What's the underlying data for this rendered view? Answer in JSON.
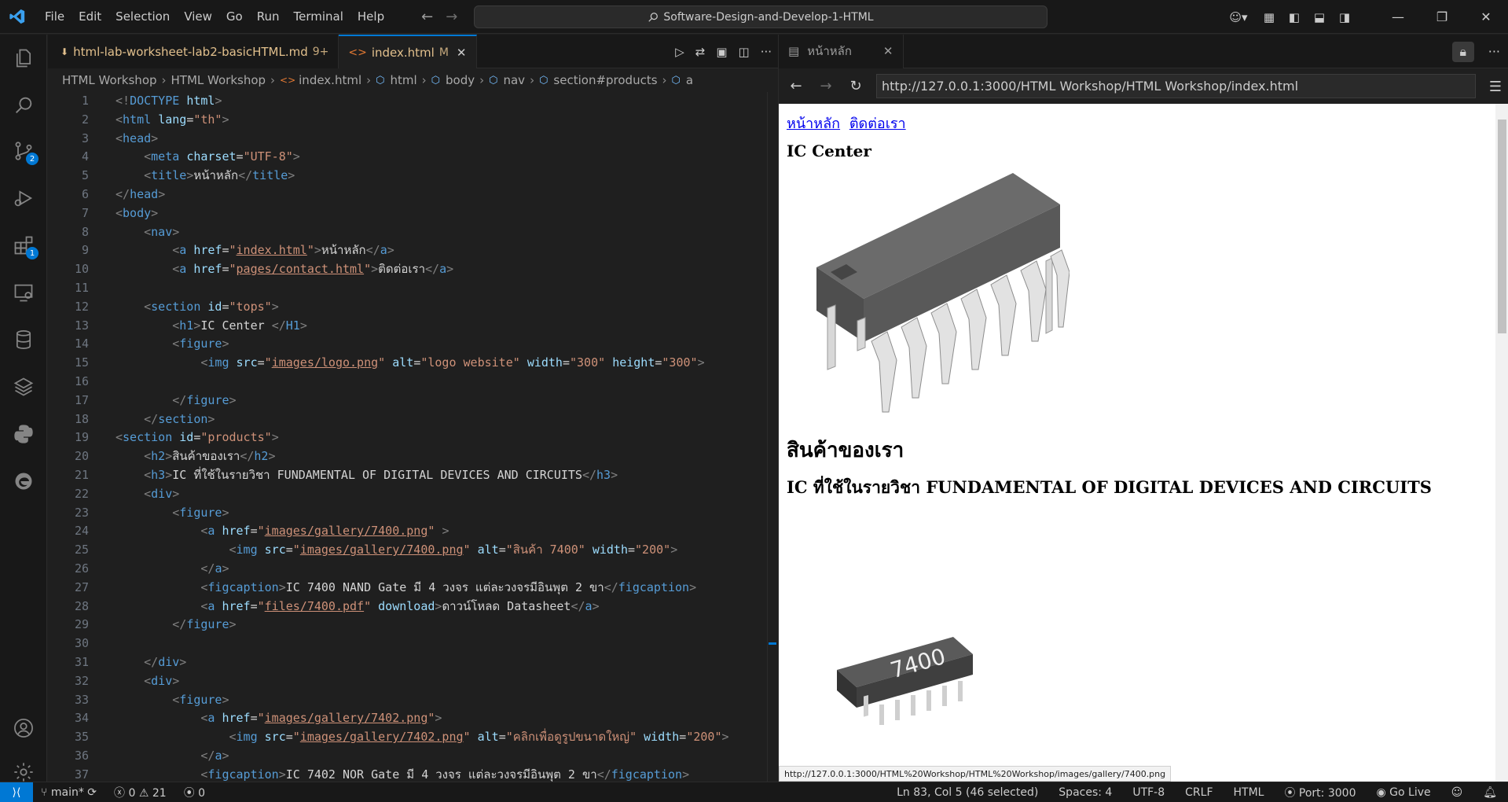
{
  "titlebar": {
    "menu": [
      "File",
      "Edit",
      "Selection",
      "View",
      "Go",
      "Run",
      "Terminal",
      "Help"
    ],
    "search_text": "Software-Design-and-Develop-1-HTML",
    "icons": [
      "copilot-icon",
      "layout-customize-icon",
      "toggle-sidebar-icon",
      "toggle-panel-icon",
      "toggle-secondary-sidebar-icon"
    ],
    "window_buttons": [
      "minimize",
      "restore",
      "close"
    ]
  },
  "activitybar": {
    "items": [
      {
        "name": "explorer-icon"
      },
      {
        "name": "search-icon"
      },
      {
        "name": "source-control-icon",
        "badge": "2"
      },
      {
        "name": "run-debug-icon"
      },
      {
        "name": "extensions-icon",
        "badge": "1"
      },
      {
        "name": "remote-explorer-icon"
      },
      {
        "name": "database-icon"
      },
      {
        "name": "layers-icon"
      },
      {
        "name": "python-icon"
      },
      {
        "name": "edge-icon"
      }
    ],
    "bottom": [
      {
        "name": "account-icon"
      },
      {
        "name": "manage-gear-icon"
      }
    ]
  },
  "editor": {
    "tabs": [
      {
        "label": "html-lab-worksheet-lab2-basicHTML.md",
        "status": "9+",
        "active": false
      },
      {
        "label": "index.html",
        "status": "M",
        "active": true
      }
    ],
    "breadcrumb": [
      "HTML Workshop",
      "HTML Workshop",
      "index.html",
      "html",
      "body",
      "nav",
      "section#products",
      "a"
    ],
    "lines": [
      "<!DOCTYPE html>",
      "<html lang=\"th\">",
      "<head>",
      "    <meta charset=\"UTF-8\">",
      "    <title>หน้าหลัก</title>",
      "</head>",
      "<body>",
      "    <nav>",
      "        <a href=\"index.html\">หน้าหลัก</a>",
      "        <a href=\"pages/contact.html\">ติดต่อเรา</a>",
      "",
      "    <section id=\"tops\">",
      "        <h1>IC Center </H1>",
      "        <figure>",
      "            <img src=\"images/logo.png\" alt=\"logo website\" width=\"300\" height=\"300\">",
      "",
      "        </figure>",
      "    </section>",
      "<section id=\"products\">",
      "    <h2>สินค้าของเรา</h2>",
      "    <h3>IC ที่ใช้ในรายวิชา FUNDAMENTAL OF DIGITAL DEVICES AND CIRCUITS</h3>",
      "    <div>",
      "        <figure>",
      "            <a href=\"images/gallery/7400.png\" >",
      "                <img src=\"images/gallery/7400.png\" alt=\"สินค้า 7400\" width=\"200\">",
      "            </a>",
      "            <figcaption>IC 7400 NAND Gate มี 4 วงจร แต่ละวงจรมีอินพุต 2 ขา</figcaption>",
      "            <a href=\"files/7400.pdf\" download>ดาวน์โหลด Datasheet</a>",
      "        </figure>",
      "",
      "    </div>",
      "    <div>",
      "        <figure>",
      "            <a href=\"images/gallery/7402.png\">",
      "                <img src=\"images/gallery/7402.png\" alt=\"คลิกเพื่อดูรูปขนาดใหญ่\" width=\"200\">",
      "            </a>",
      "            <figcaption>IC 7402 NOR Gate มี 4 วงจร แต่ละวงจรมีอินพุต 2 ขา</figcaption>"
    ]
  },
  "preview": {
    "tab_label": "หน้าหลัก",
    "url": "http://127.0.0.1:3000/HTML Workshop/HTML Workshop/index.html",
    "page": {
      "nav_links": [
        "หน้าหลัก",
        "ติดต่อเรา"
      ],
      "h1": "IC Center",
      "h2": "สินค้าของเรา",
      "h3": "IC ที่ใช้ในรายวิชา FUNDAMENTAL OF DIGITAL DEVICES AND CIRCUITS",
      "chip_label": "7400",
      "hover_url": "http://127.0.0.1:3000/HTML%20Workshop/HTML%20Workshop/images/gallery/7400.png"
    }
  },
  "statusbar": {
    "branch": "main*",
    "errors": "0",
    "warnings": "21",
    "ports": "0",
    "position": "Ln 83, Col 5 (46 selected)",
    "spaces": "Spaces: 4",
    "encoding": "UTF-8",
    "eol": "CRLF",
    "language": "HTML",
    "port": "Port: 3000",
    "golive": "Go Live"
  },
  "colors": {
    "accent": "#0078d4",
    "tag": "#569cd6",
    "attr": "#9cdcfe",
    "value": "#ce9178",
    "modified": "#e2c08d",
    "link": "#0000ee"
  }
}
